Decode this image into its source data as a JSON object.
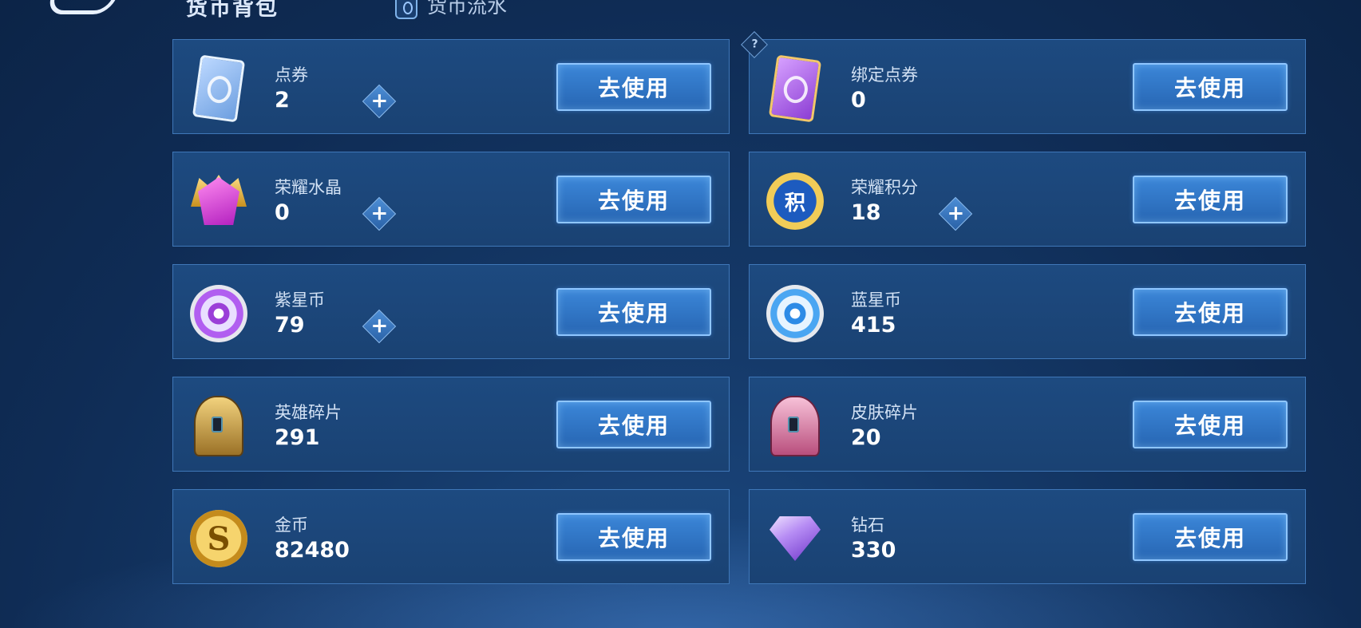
{
  "header": {
    "title": "货币背包",
    "history_tab": "货币流水"
  },
  "cards": [
    {
      "name": "点券",
      "amount": "2",
      "button": "去使用",
      "icon": "blue-ticket-icon",
      "has_plus": true
    },
    {
      "name": "绑定点券",
      "amount": "0",
      "button": "去使用",
      "icon": "purple-ticket-icon",
      "has_plus": false,
      "help": "?"
    },
    {
      "name": "荣耀水晶",
      "amount": "0",
      "button": "去使用",
      "icon": "glory-crystal-icon",
      "has_plus": true
    },
    {
      "name": "荣耀积分",
      "amount": "18",
      "button": "去使用",
      "icon": "glory-points-icon",
      "has_plus": true,
      "icon_glyph": "积"
    },
    {
      "name": "紫星币",
      "amount": "79",
      "button": "去使用",
      "icon": "purple-star-coin-icon",
      "has_plus": true
    },
    {
      "name": "蓝星币",
      "amount": "415",
      "button": "去使用",
      "icon": "blue-star-coin-icon",
      "has_plus": false
    },
    {
      "name": "英雄碎片",
      "amount": "291",
      "button": "去使用",
      "icon": "hero-shard-icon",
      "has_plus": false
    },
    {
      "name": "皮肤碎片",
      "amount": "20",
      "button": "去使用",
      "icon": "skin-shard-icon",
      "has_plus": false
    },
    {
      "name": "金币",
      "amount": "82480",
      "button": "去使用",
      "icon": "gold-coin-icon",
      "has_plus": false,
      "icon_glyph": "S"
    },
    {
      "name": "钻石",
      "amount": "330",
      "button": "去使用",
      "icon": "diamond-icon",
      "has_plus": false
    }
  ],
  "plus_symbol": "+"
}
